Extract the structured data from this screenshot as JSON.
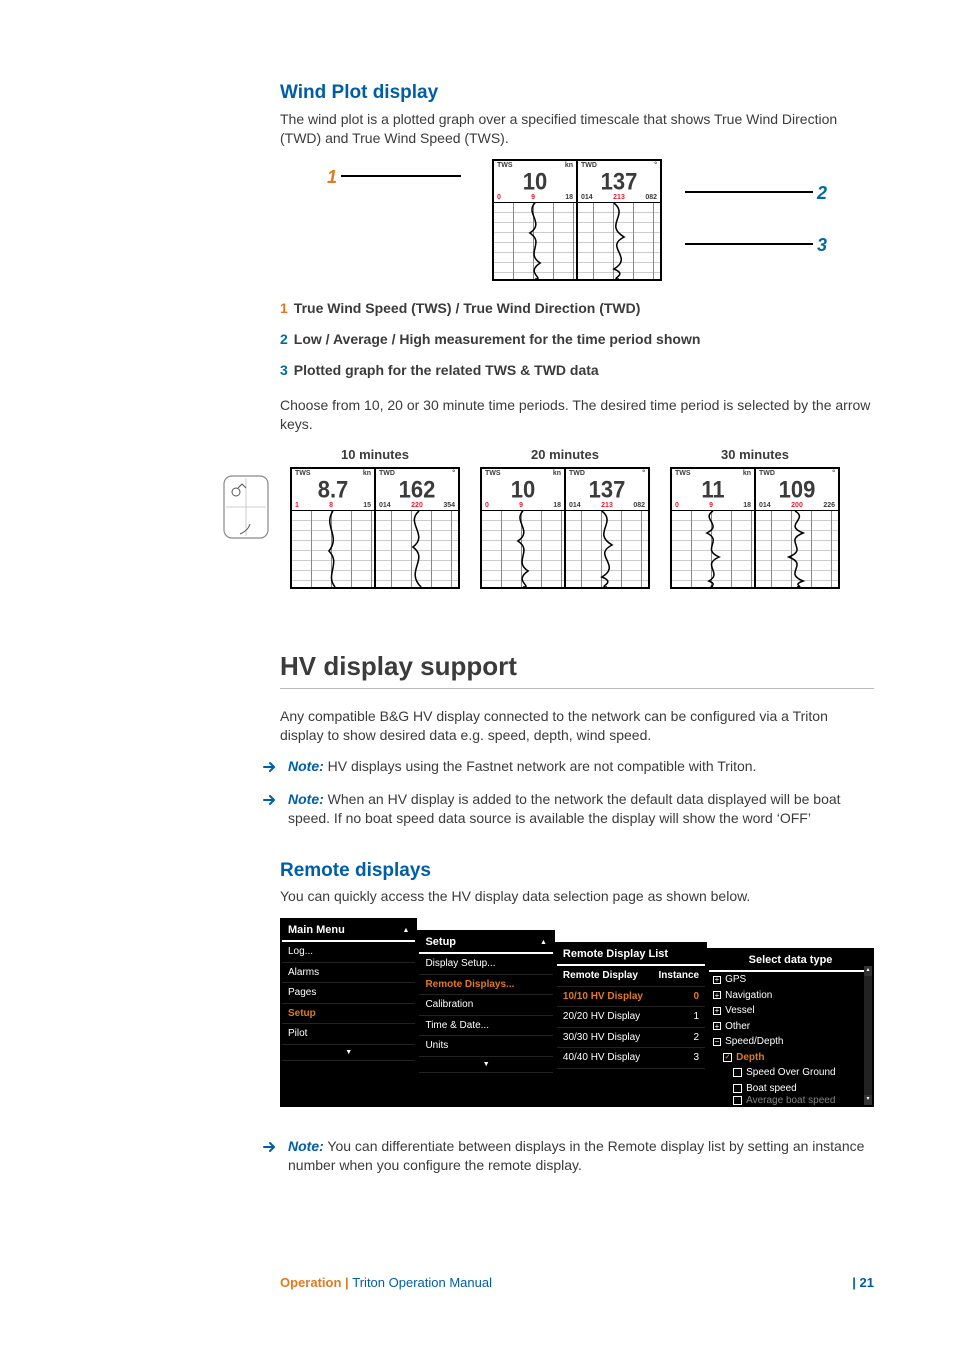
{
  "wind_plot": {
    "title": "Wind Plot display",
    "body": "The wind plot is a plotted graph over a specified timescale that shows True Wind Direction (TWD) and True Wind Speed (TWS).",
    "legend": [
      {
        "n": "1",
        "text": "True Wind Speed (TWS) / True Wind Direction (TWD)"
      },
      {
        "n": "2",
        "text": "Low / Average / High measurement for the time period shown"
      },
      {
        "n": "3",
        "text": "Plotted graph for the related TWS & TWD data"
      }
    ],
    "periods_intro": "Choose from 10, 20 or 30 minute time periods. The desired time period is selected by the arrow keys.",
    "annot_labels": {
      "n1": "1",
      "n2": "2",
      "n3": "3"
    }
  },
  "chart_data": {
    "type": "table",
    "title": "Wind Plot readings at different time periods",
    "series": [
      {
        "name": "10 minutes",
        "tws": 8.7,
        "tws_low": 1,
        "tws_avg": 8,
        "tws_high": 15,
        "twd": 162,
        "twd_low": "014",
        "twd_avg": 220,
        "twd_high": 354
      },
      {
        "name": "20 minutes",
        "tws": 10.0,
        "tws_low": 0,
        "tws_avg": 9,
        "tws_high": 18,
        "twd": 137,
        "twd_low": "014",
        "twd_avg": 213,
        "twd_high": "082"
      },
      {
        "name": "30 minutes",
        "tws": 11.0,
        "tws_low": 0,
        "tws_avg": 9,
        "tws_high": 18,
        "twd": 109,
        "twd_low": "014",
        "twd_avg": 200,
        "twd_high": 226
      }
    ],
    "units": {
      "tws": "kn",
      "twd": "°"
    },
    "col_labels": {
      "tws": "TWS",
      "twd": "TWD"
    }
  },
  "hv": {
    "title": "HV display support",
    "body": "Any compatible B&G HV display connected to the network can be configured via a Triton display to show desired data e.g. speed, depth, wind speed.",
    "note1": "HV displays using the Fastnet network are not compatible with Triton.",
    "note2": "When an HV display is added to the network the default data displayed will be boat speed. If no boat speed data source is available the display will show the word ‘OFF’",
    "note3": "You can differentiate between displays in the Remote display list by setting an instance number when you configure the remote display.",
    "note_label": "Note:"
  },
  "remote": {
    "title": "Remote displays",
    "body": "You can quickly access the HV display data selection page as shown below."
  },
  "menus": {
    "main": {
      "title": "Main Menu",
      "items": [
        "Log...",
        "Alarms",
        "Pages",
        "Setup",
        "Pilot"
      ],
      "selected": 3
    },
    "setup": {
      "title": "Setup",
      "items": [
        "Display Setup...",
        "Remote Displays...",
        "Calibration",
        "Time & Date...",
        "Units"
      ],
      "selected": 1
    },
    "remote_list": {
      "title": "Remote Display List",
      "header": [
        "Remote Display",
        "Instance"
      ],
      "rows": [
        [
          "10/10 HV Display",
          "0"
        ],
        [
          "20/20 HV Display",
          "1"
        ],
        [
          "30/30 HV Display",
          "2"
        ],
        [
          "40/40 HV Display",
          "3"
        ]
      ],
      "selected": 0
    },
    "data_type": {
      "title": "Select data type",
      "items": [
        {
          "label": "GPS",
          "expand": "plus",
          "indent": 0
        },
        {
          "label": "Navigation",
          "expand": "plus",
          "indent": 0
        },
        {
          "label": "Vessel",
          "expand": "plus",
          "indent": 0
        },
        {
          "label": "Other",
          "expand": "plus",
          "indent": 0
        },
        {
          "label": "Speed/Depth",
          "expand": "minus",
          "indent": 0
        },
        {
          "label": "Depth",
          "checked": true,
          "indent": 1,
          "selected": true
        },
        {
          "label": "Speed Over Ground",
          "checked": false,
          "indent": 2
        },
        {
          "label": "Boat speed",
          "checked": false,
          "indent": 2
        },
        {
          "label": "Average boat speed",
          "checked": false,
          "indent": 2,
          "cut": true
        }
      ]
    }
  },
  "footer": {
    "section": "Operation | ",
    "manual": "Triton Operation Manual",
    "page": "| 21"
  }
}
